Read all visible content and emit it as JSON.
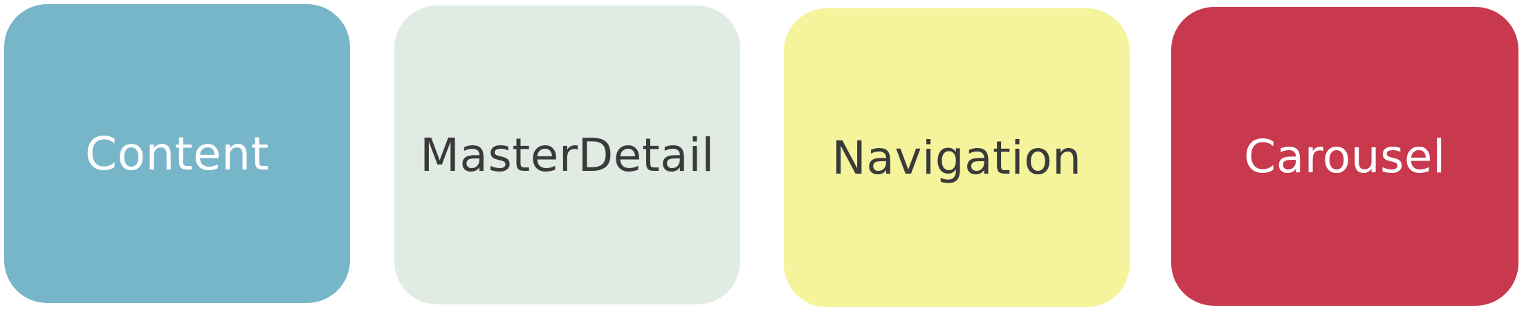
{
  "tiles": [
    {
      "label": "Content",
      "background": "#77b6c9",
      "text_color": "#ffffff"
    },
    {
      "label": "MasterDetail",
      "background": "#e0ebe4",
      "text_color": "#3a3a3a"
    },
    {
      "label": "Navigation",
      "background": "#f5f49c",
      "text_color": "#3a3a3a"
    },
    {
      "label": "Carousel",
      "background": "#c8394d",
      "text_color": "#ffffff"
    }
  ]
}
